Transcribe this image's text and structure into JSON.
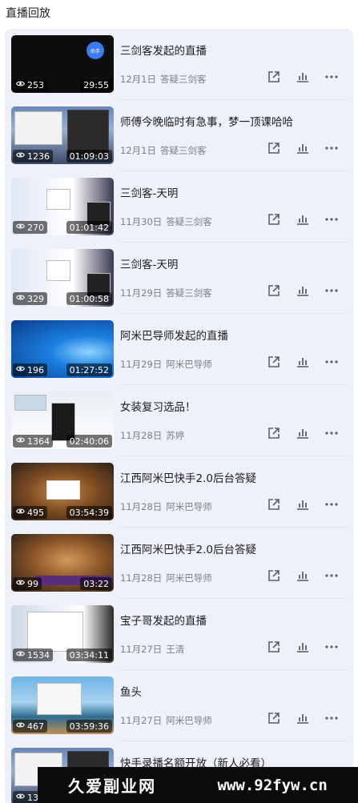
{
  "header": {
    "title": "直播回放"
  },
  "items": [
    {
      "title": "三剑客发起的直播",
      "date": "12月1日",
      "host": "答疑三剑客",
      "views": "253",
      "duration": "29:55",
      "thumb": "dark-avatar"
    },
    {
      "title": "师傅今晚临时有急事，梦一顶课哈哈",
      "date": "12月1日",
      "host": "答疑三剑客",
      "views": "1236",
      "duration": "01:09:03",
      "thumb": "desktop-photo"
    },
    {
      "title": "三剑客-天明",
      "date": "11月30日",
      "host": "答疑三剑客",
      "views": "270",
      "duration": "01:01:42",
      "thumb": "desktop-dialog"
    },
    {
      "title": "三剑客-天明",
      "date": "11月29日",
      "host": "答疑三剑客",
      "views": "329",
      "duration": "01:00:58",
      "thumb": "desktop-dialog"
    },
    {
      "title": "阿米巴导师发起的直播",
      "date": "11月29日",
      "host": "阿米巴导师",
      "views": "196",
      "duration": "01:27:52",
      "thumb": "windows-blue"
    },
    {
      "title": "女装复习选品！",
      "date": "11月28日",
      "host": "苏婷",
      "views": "1364",
      "duration": "02:40:06",
      "thumb": "shop-page"
    },
    {
      "title": "江西阿米巴快手2.0后台答疑",
      "date": "11月28日",
      "host": "阿米巴导师",
      "views": "495",
      "duration": "03:54:39",
      "thumb": "tiger-dialog"
    },
    {
      "title": "江西阿米巴快手2.0后台答疑",
      "date": "11月28日",
      "host": "阿米巴导师",
      "views": "99",
      "duration": "03:22",
      "thumb": "tiger"
    },
    {
      "title": "宝子哥发起的直播",
      "date": "11月27日",
      "host": "王清",
      "views": "1534",
      "duration": "03:34:11",
      "thumb": "chat-window"
    },
    {
      "title": "鱼头",
      "date": "11月27日",
      "host": "阿米巴导师",
      "views": "467",
      "duration": "03:59:36",
      "thumb": "coast"
    },
    {
      "title": "快手录播名额开放（新人必看）",
      "date": "",
      "host": "",
      "views": "13",
      "duration": "",
      "thumb": "desktop-photo"
    }
  ],
  "thumb_avatar_label": "助手",
  "watermark": {
    "left": "久爱副业网",
    "right": "www.92fyw.cn"
  }
}
